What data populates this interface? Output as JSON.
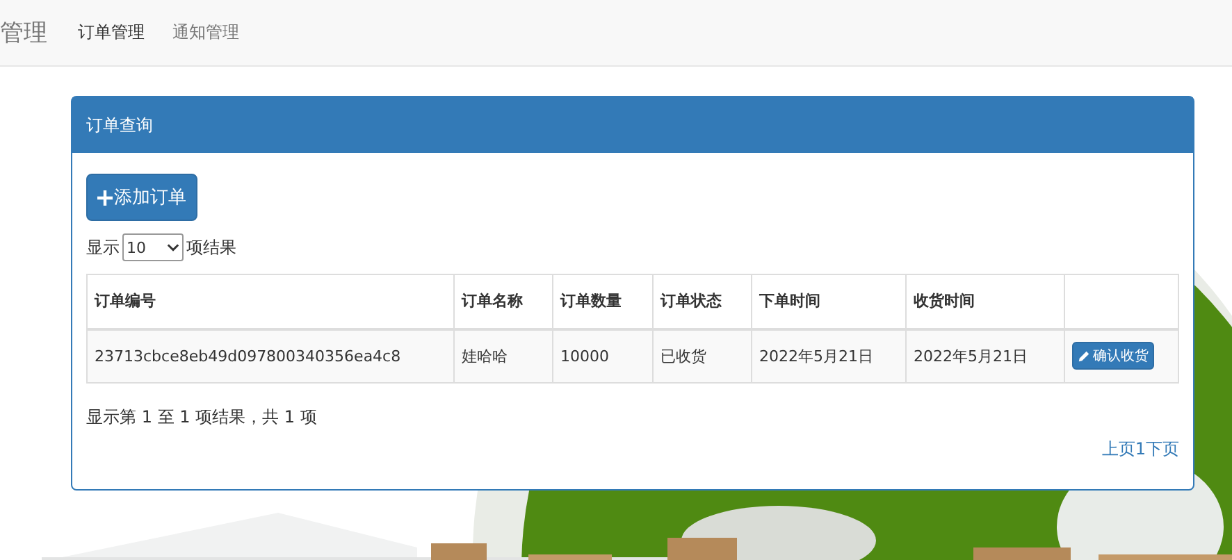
{
  "navbar": {
    "brand": "管理",
    "items": [
      {
        "label": "订单管理",
        "selected": true
      },
      {
        "label": "通知管理",
        "selected": false
      }
    ]
  },
  "panel": {
    "title": "订单查询",
    "add_button": "添加订单",
    "length": {
      "prefix": "显示",
      "value": "10",
      "suffix": "项结果"
    },
    "table": {
      "columns": [
        "订单编号",
        "订单名称",
        "订单数量",
        "订单状态",
        "下单时间",
        "收货时间"
      ],
      "rows": [
        {
          "cells": [
            "23713cbce8eb49d097800340356ea4c8",
            "娃哈哈",
            "10000",
            "已收货",
            "2022年5月21日",
            "2022年5月21日"
          ],
          "action": "确认收货"
        }
      ]
    },
    "info": "显示第 1 至 1 项结果，共 1 项",
    "pagination": "上页1下页"
  }
}
